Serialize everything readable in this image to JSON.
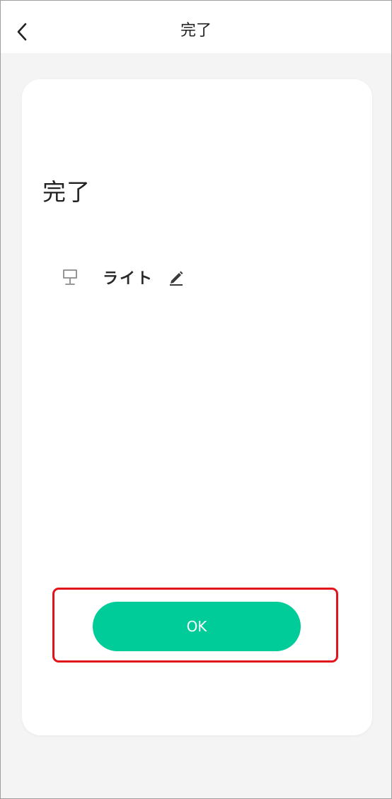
{
  "header": {
    "title": "完了",
    "back_icon": "chevron-left-icon"
  },
  "card": {
    "title": "完了",
    "device": {
      "icon": "lamp-icon",
      "name": "ライト",
      "edit_icon": "pencil-icon"
    },
    "ok_label": "OK"
  },
  "colors": {
    "accent": "#00cc99",
    "highlight": "#e0141b",
    "background": "#f4f4f4",
    "card": "#ffffff"
  }
}
